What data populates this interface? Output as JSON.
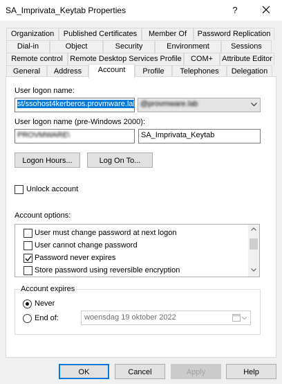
{
  "window": {
    "title": "SA_Imprivata_Keytab Properties",
    "help_glyph": "?",
    "close_icon": "close-icon"
  },
  "tabs": {
    "row1": [
      "Organization",
      "Published Certificates",
      "Member Of",
      "Password Replication"
    ],
    "row2": [
      "Dial-in",
      "Object",
      "Security",
      "Environment",
      "Sessions"
    ],
    "row3": [
      "Remote control",
      "Remote Desktop Services Profile",
      "COM+",
      "Attribute Editor"
    ],
    "row4": [
      "General",
      "Address",
      "Account",
      "Profile",
      "Telephones",
      "Delegation"
    ],
    "active": "Account"
  },
  "account": {
    "logon_name_label": "User logon name:",
    "logon_name_value": "st/ssohost4kerberos.provmware.lab",
    "domain_suffix": "@provmware.lab",
    "pre2000_label": "User logon name (pre-Windows 2000):",
    "pre2000_domain": "PROVMWARE\\",
    "pre2000_user": "SA_Imprivata_Keytab",
    "logon_hours_button": "Logon Hours...",
    "logon_to_button": "Log On To...",
    "unlock_label": "Unlock account",
    "options_label": "Account options:",
    "options": [
      {
        "label": "User must change password at next logon",
        "checked": false
      },
      {
        "label": "User cannot change password",
        "checked": false
      },
      {
        "label": "Password never expires",
        "checked": true
      },
      {
        "label": "Store password using reversible encryption",
        "checked": false
      }
    ],
    "expires_label": "Account expires",
    "never_label": "Never",
    "endof_label": "End of:",
    "end_date": "woensdag  19   oktober   2022"
  },
  "buttons": {
    "ok": "OK",
    "cancel": "Cancel",
    "apply": "Apply",
    "help": "Help"
  },
  "colors": {
    "accent": "#0078d7",
    "face": "#f0f0f0"
  }
}
